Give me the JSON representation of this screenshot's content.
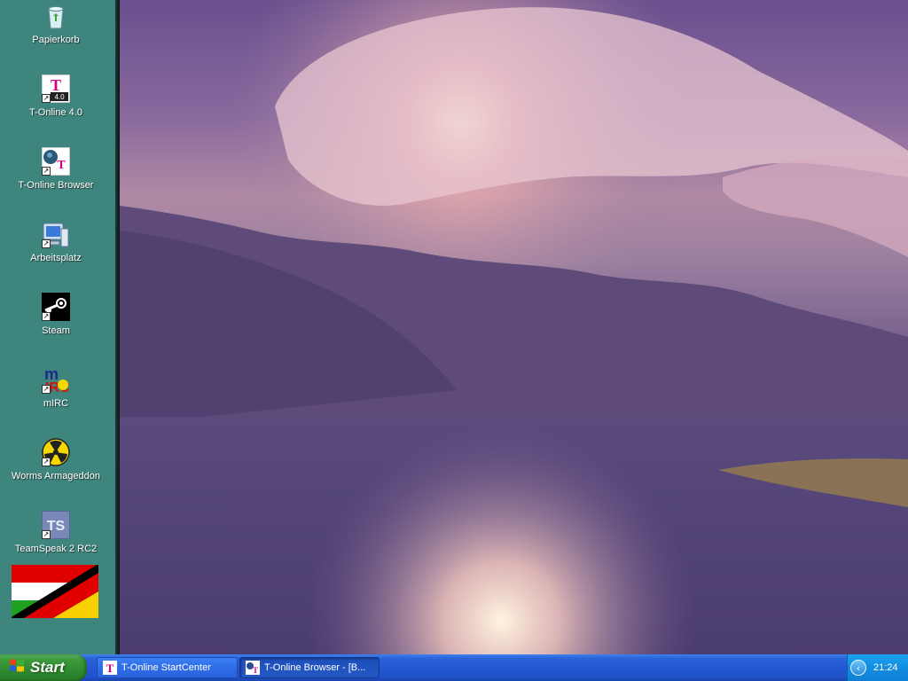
{
  "desktop": {
    "icons": [
      {
        "label": "Papierkorb",
        "icon": "recycle-bin-icon"
      },
      {
        "label": "T-Online 4.0",
        "icon": "t-online-icon",
        "badge": "4.0"
      },
      {
        "label": "T-Online Browser",
        "icon": "t-online-browser-icon"
      },
      {
        "label": "Arbeitsplatz",
        "icon": "my-computer-icon"
      },
      {
        "label": "Steam",
        "icon": "steam-icon"
      },
      {
        "label": "mIRC",
        "icon": "mirc-icon"
      },
      {
        "label": "Worms Armageddon",
        "icon": "radiation-icon"
      },
      {
        "label": "TeamSpeak 2 RC2",
        "icon": "teamspeak-icon",
        "badge": "TS"
      }
    ],
    "sidebar_color": "#3e857d"
  },
  "taskbar": {
    "start_label": "Start",
    "tasks": [
      {
        "label": "T-Online StartCenter",
        "icon": "t-online-icon",
        "active": false
      },
      {
        "label": "T-Online Browser - [B...",
        "icon": "t-online-browser-icon",
        "active": true
      }
    ],
    "clock": "21:24"
  }
}
